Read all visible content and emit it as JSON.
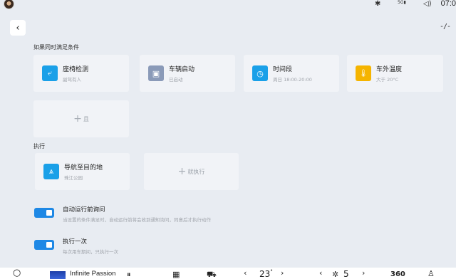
{
  "status_bar": {
    "time": "07:0",
    "bluetooth_icon": "bluetooth-icon",
    "signal_icon": "signal-icon",
    "signal_label": "5G",
    "volume_icon": "volume-icon"
  },
  "header": {
    "back_glyph": "‹",
    "settings_glyph": "-/-"
  },
  "conditions": {
    "label": "如果同时满足条件",
    "cards": [
      {
        "title": "座椅检测",
        "subtitle": "副驾有人",
        "icon": "seat-icon",
        "glyph": "⤶",
        "color": "#1aa0e8"
      },
      {
        "title": "车辆启动",
        "subtitle": "已启动",
        "icon": "car-icon",
        "glyph": "▣",
        "color": "#8a9ab8"
      },
      {
        "title": "时间段",
        "subtitle": "周日 18:00-20:00",
        "icon": "clock-icon",
        "glyph": "◷",
        "color": "#1aa0e8"
      },
      {
        "title": "车外温度",
        "subtitle": "大于 20°C",
        "icon": "thermometer-icon",
        "glyph": "🌡",
        "color": "#f5b400"
      }
    ],
    "add_label": "且",
    "add_plus": "+"
  },
  "actions": {
    "label": "执行",
    "cards": [
      {
        "title": "导航至目的地",
        "subtitle": "珠江公园",
        "icon": "navigation-icon",
        "glyph": "⩓",
        "color": "#1aa0e8"
      }
    ],
    "add_label": "就执行",
    "add_plus": "+"
  },
  "options": [
    {
      "title": "自动运行前询问",
      "desc": "当设置的条件满足时，自动运行前将会收到通知询问，同意后才执行动作",
      "enabled": true
    },
    {
      "title": "执行一次",
      "desc": "每次用车期间，只执行一次",
      "enabled": true
    }
  ],
  "bottom_bar": {
    "search_glyph": "○",
    "media_title": "Infinite Passion",
    "pause_glyph": "⏸",
    "apps_glyph": "▦",
    "car_glyph": "⛟",
    "temp_left_arrow": "‹",
    "temp_value": "23",
    "temp_unit": "°",
    "temp_right_arrow": "›",
    "fan_left_arrow": "‹",
    "fan_glyph": "✲",
    "fan_value": "5",
    "fan_right_arrow": "›",
    "view_label": "360",
    "seat_glyph": "♙"
  }
}
